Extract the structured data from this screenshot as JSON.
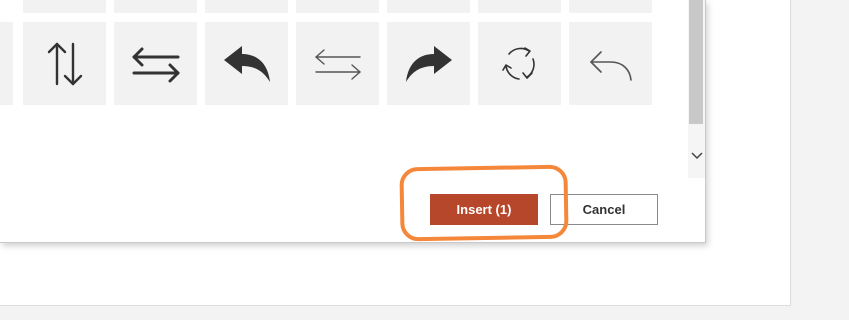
{
  "dialog": {
    "icon_tiles_row_top": [
      {
        "icon": "partial-tile"
      },
      {
        "icon": "partial-tile"
      },
      {
        "icon": "partial-tile"
      },
      {
        "icon": "partial-tile"
      },
      {
        "icon": "partial-tile"
      },
      {
        "icon": "partial-tile"
      },
      {
        "icon": "partial-tile"
      }
    ],
    "icon_tiles": [
      {
        "icon": "up-down-arrows-icon"
      },
      {
        "icon": "left-right-arrows-icon"
      },
      {
        "icon": "reply-arrow-solid-icon"
      },
      {
        "icon": "left-right-arrows-thin-icon"
      },
      {
        "icon": "forward-arrow-solid-icon"
      },
      {
        "icon": "refresh-cycle-icon"
      },
      {
        "icon": "undo-arrow-thin-icon"
      }
    ],
    "buttons": {
      "insert_label": "Insert (1)",
      "cancel_label": "Cancel"
    }
  },
  "colors": {
    "accent": "#b7472a",
    "highlight": "#f5873a",
    "tile_bg": "#f2f2f2",
    "icon": "#333333"
  }
}
